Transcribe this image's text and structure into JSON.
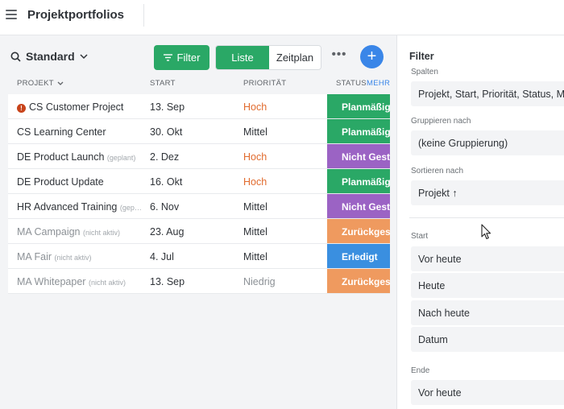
{
  "topbar": {
    "title": "Projektportfolios"
  },
  "toolbar": {
    "view_label": "Standard",
    "filter_label": "Filter",
    "list_label": "Liste",
    "timeline_label": "Zeitplan",
    "more_label": "•••",
    "add_label": "+"
  },
  "columns": {
    "project": "PROJEKT",
    "start": "START",
    "priority": "PRIORITÄT",
    "status": "STATUS",
    "more": "MEHR"
  },
  "rows": [
    {
      "name": "CS Customer Project",
      "tag": "",
      "warning": true,
      "inactive": false,
      "start": "13. Sep",
      "priority": "Hoch",
      "status": "Planmäßig",
      "status_color": "#2aa866"
    },
    {
      "name": "CS Learning Center",
      "tag": "",
      "warning": false,
      "inactive": false,
      "start": "30. Okt",
      "priority": "Mittel",
      "status": "Planmäßig",
      "status_color": "#2aa866"
    },
    {
      "name": "DE Product Launch",
      "tag": "(geplant)",
      "warning": false,
      "inactive": false,
      "start": "2. Dez",
      "priority": "Hoch",
      "status": "Nicht Gestartet",
      "status_color": "#9b63c4"
    },
    {
      "name": "DE Product Update",
      "tag": "",
      "warning": false,
      "inactive": false,
      "start": "16. Okt",
      "priority": "Hoch",
      "status": "Planmäßig",
      "status_color": "#2aa866"
    },
    {
      "name": "HR Advanced Training",
      "tag": "(gep…",
      "warning": false,
      "inactive": false,
      "start": "6. Nov",
      "priority": "Mittel",
      "status": "Nicht Gestartet",
      "status_color": "#9b63c4"
    },
    {
      "name": "MA Campaign",
      "tag": "(nicht aktiv)",
      "warning": false,
      "inactive": true,
      "start": "23. Aug",
      "priority": "Mittel",
      "status": "Zurückgestellt",
      "status_color": "#ef9a5f"
    },
    {
      "name": "MA Fair",
      "tag": "(nicht aktiv)",
      "warning": false,
      "inactive": true,
      "start": "4. Jul",
      "priority": "Mittel",
      "status": "Erledigt",
      "status_color": "#3a8fe0"
    },
    {
      "name": "MA Whitepaper",
      "tag": "(nicht aktiv)",
      "warning": false,
      "inactive": true,
      "start": "13. Sep",
      "priority": "Niedrig",
      "status": "Zurückgestellt",
      "status_color": "#ef9a5f"
    }
  ],
  "panel": {
    "title": "Filter",
    "columns_label": "Spalten",
    "columns_value": "Projekt, Start, Priorität, Status, Manager",
    "group_label": "Gruppieren nach",
    "group_value": "(keine Gruppierung)",
    "sort_label": "Sortieren nach",
    "sort_value": "Projekt ↑",
    "start_label": "Start",
    "start_options": [
      "Vor heute",
      "Heute",
      "Nach heute",
      "Datum"
    ],
    "end_label": "Ende",
    "end_options": [
      "Vor heute"
    ]
  }
}
